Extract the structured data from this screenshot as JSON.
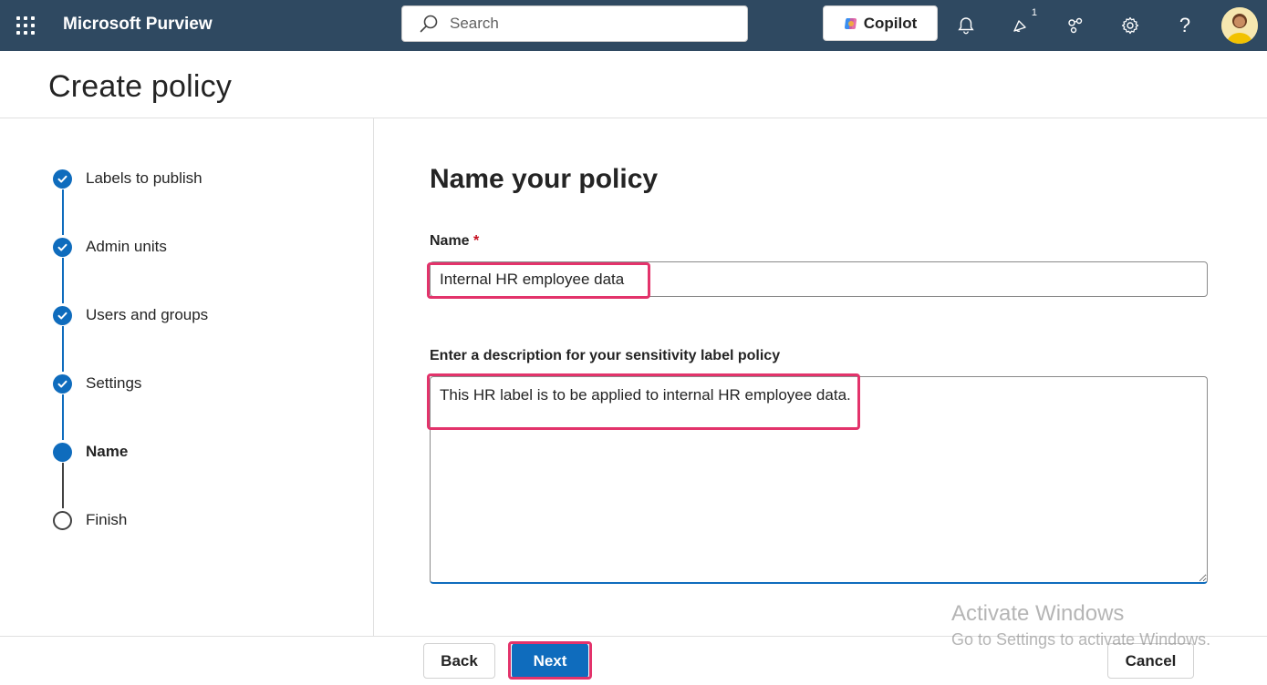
{
  "header": {
    "app_title": "Microsoft Purview",
    "search_placeholder": "Search",
    "copilot_label": "Copilot",
    "notification_count": "1"
  },
  "page": {
    "title": "Create policy"
  },
  "steps": [
    {
      "label": "Labels to publish",
      "status": "completed"
    },
    {
      "label": "Admin units",
      "status": "completed"
    },
    {
      "label": "Users and groups",
      "status": "completed"
    },
    {
      "label": "Settings",
      "status": "completed"
    },
    {
      "label": "Name",
      "status": "current"
    },
    {
      "label": "Finish",
      "status": "pending"
    }
  ],
  "form": {
    "heading": "Name your policy",
    "name_label": "Name",
    "required_marker": "*",
    "name_value": "Internal HR employee data",
    "description_label": "Enter a description for your sensitivity label policy",
    "description_value": "This HR label is to be applied to internal HR employee data."
  },
  "footer": {
    "back_label": "Back",
    "next_label": "Next",
    "cancel_label": "Cancel"
  },
  "watermark": {
    "line1": "Activate Windows",
    "line2": "Go to Settings to activate Windows."
  },
  "colors": {
    "topbar": "#2f4961",
    "accent": "#0f6cbd",
    "highlight": "#e3336b",
    "required": "#c50f1f"
  }
}
